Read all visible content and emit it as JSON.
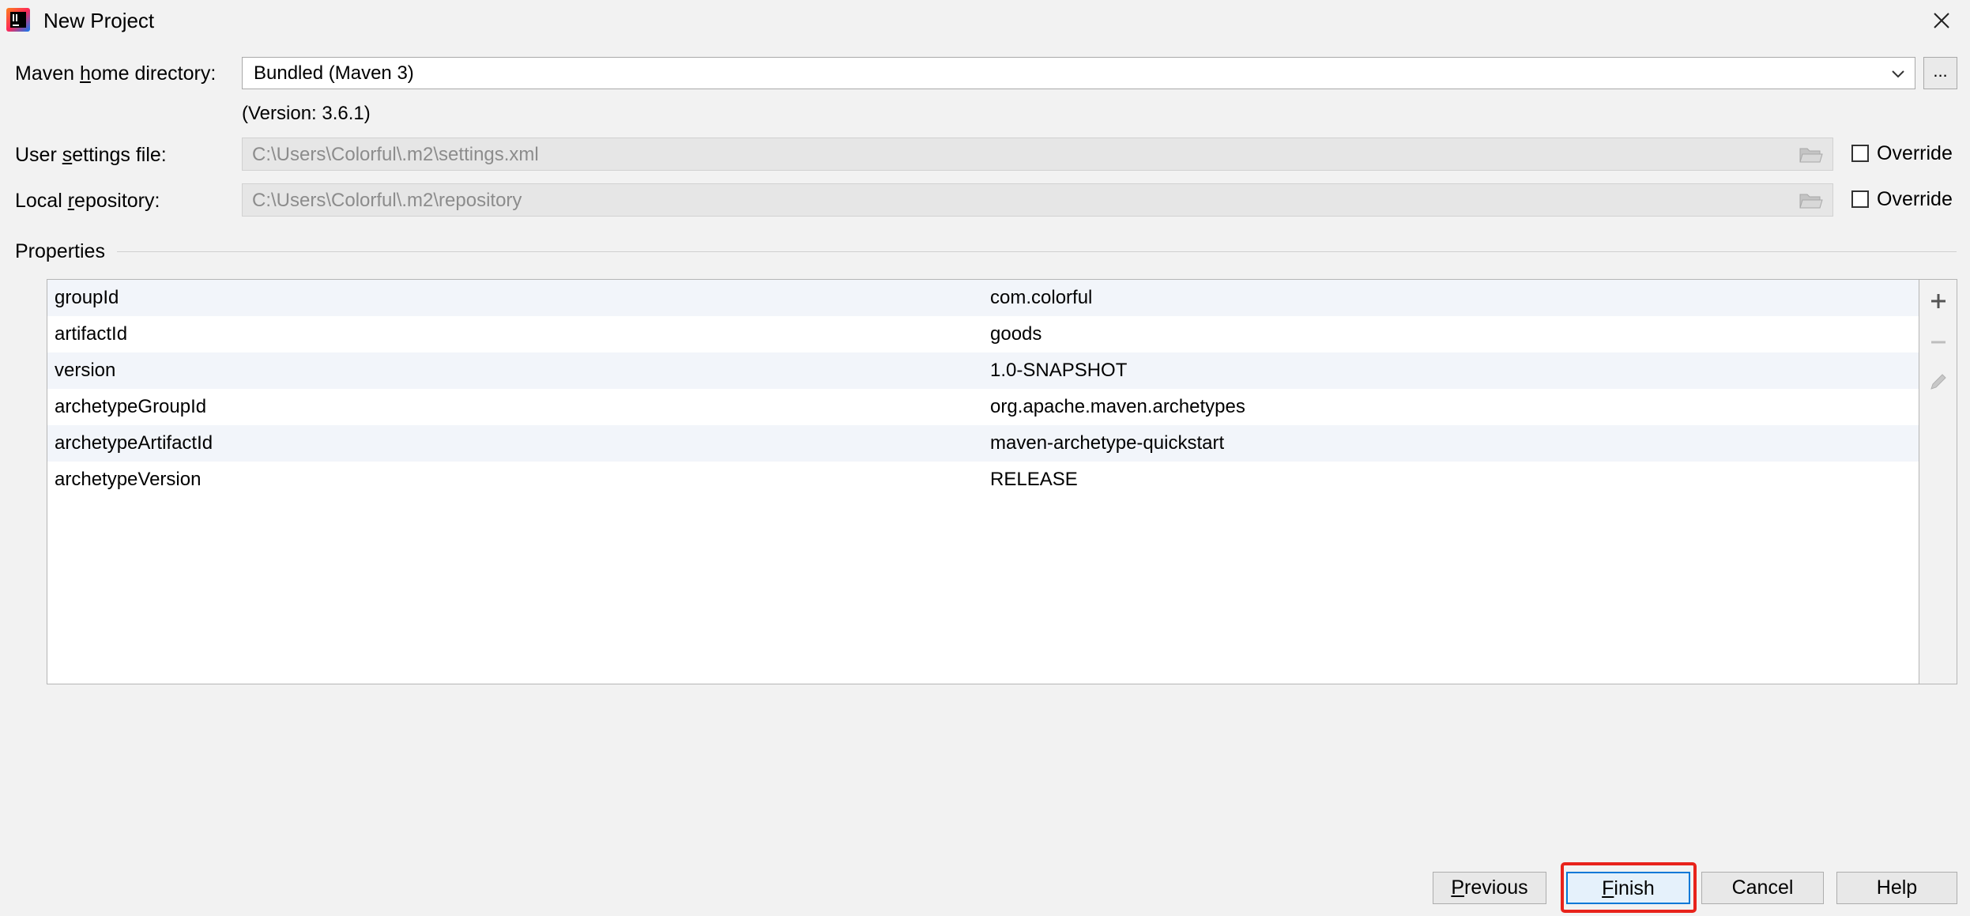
{
  "window": {
    "title": "New Project",
    "app_icon": "intellij-idea-icon",
    "close_icon": "close-icon"
  },
  "form": {
    "maven_home": {
      "label_pre": "Maven ",
      "label_u": "h",
      "label_post": "ome directory:",
      "value": "Bundled (Maven 3)",
      "browse_label": "...",
      "version_text": "(Version: 3.6.1)"
    },
    "user_settings": {
      "label_pre": "User ",
      "label_u": "s",
      "label_post": "ettings file:",
      "value": "C:\\Users\\Colorful\\.m2\\settings.xml",
      "override_label": "Override",
      "override_checked": false
    },
    "local_repo": {
      "label_pre": "Local ",
      "label_u": "r",
      "label_post": "epository:",
      "value": "C:\\Users\\Colorful\\.m2\\repository",
      "override_label": "Override",
      "override_checked": false
    }
  },
  "properties": {
    "section_title": "Properties",
    "rows": [
      {
        "key": "groupId",
        "value": "com.colorful"
      },
      {
        "key": "artifactId",
        "value": "goods"
      },
      {
        "key": "version",
        "value": "1.0-SNAPSHOT"
      },
      {
        "key": "archetypeGroupId",
        "value": "org.apache.maven.archetypes"
      },
      {
        "key": "archetypeArtifactId",
        "value": "maven-archetype-quickstart"
      },
      {
        "key": "archetypeVersion",
        "value": "RELEASE"
      }
    ],
    "side_toolbar": [
      "add-icon",
      "remove-icon",
      "edit-icon"
    ]
  },
  "buttons": {
    "previous": {
      "u": "P",
      "rest": "revious"
    },
    "finish": {
      "u": "F",
      "rest": "inish"
    },
    "cancel": {
      "label": "Cancel"
    },
    "help": {
      "label": "Help"
    }
  },
  "colors": {
    "background": "#f2f2f2",
    "accent": "#0078d7",
    "highlight": "#e8231b",
    "alt_row": "#f2f5fa"
  }
}
